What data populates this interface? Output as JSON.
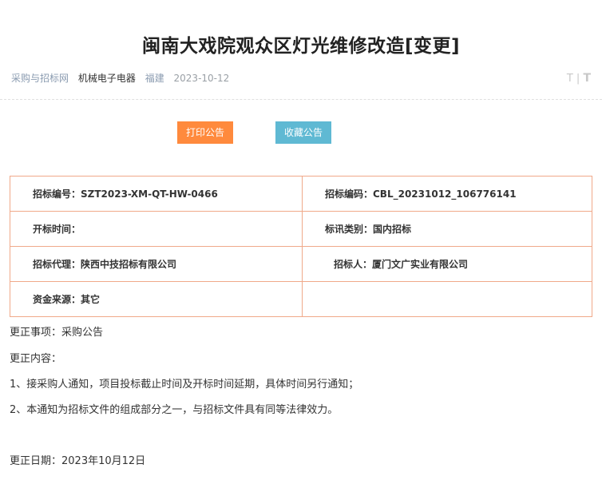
{
  "title": "闽南大戏院观众区灯光维修改造[变更]",
  "meta": {
    "site": "采购与招标网",
    "category": "机械电子电器",
    "region": "福建",
    "date": "2023-10-12"
  },
  "font_tool": {
    "small": "T",
    "separator": "|",
    "large": "T"
  },
  "buttons": {
    "print": "打印公告",
    "favorite": "收藏公告"
  },
  "info_table": {
    "bid_no": "招标编号：SZT2023-XM-QT-HW-0466",
    "bid_code": "招标编码：CBL_20231012_106776141",
    "open_time": "开标时间：",
    "bid_type": "标讯类别：国内招标",
    "agent": "招标代理：陕西中技招标有限公司",
    "tenderer": "招标人：厦门文广实业有限公司",
    "fund_source": "资金来源：其它",
    "empty": ""
  },
  "body": {
    "matter": "更正事项：采购公告",
    "content_label": "更正内容：",
    "item1": "1、接采购人通知，项目投标截止时间及开标时间延期，具体时间另行通知；",
    "item2": "2、本通知为招标文件的组成部分之一，与招标文件具有同等法律效力。",
    "date": "更正日期：2023年10月12日"
  }
}
